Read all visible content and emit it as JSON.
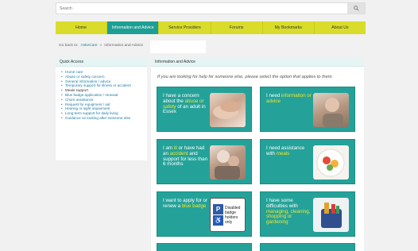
{
  "search": {
    "placeholder": "Search"
  },
  "nav": {
    "items": [
      {
        "label": "Home"
      },
      {
        "label": "Information and Advice"
      },
      {
        "label": "Service Providers"
      },
      {
        "label": "Forums"
      },
      {
        "label": "My Bookmarks"
      },
      {
        "label": "About Us"
      }
    ],
    "active_index": 1
  },
  "breadcrumb": {
    "prefix": "Go back to:",
    "link": "AskeCare",
    "separator": "»",
    "current": "Information and Advice"
  },
  "sidebar": {
    "title": "Quick Access",
    "items": [
      "Home care",
      "Abuse or safety concern",
      "General information / advice",
      "Temporary support for illness or accident",
      "Meals support",
      "Blue badge application / renewal",
      "Chore assistance",
      "Request for equipment / aid",
      "Hearing or sight impairment",
      "Long-term support for daily living",
      "Guidance on looking after someone else"
    ]
  },
  "main": {
    "title": "Information and Advice",
    "intro": "If you are looking for help for someone else, please select the option that applies to them.",
    "tiles": {
      "t1": {
        "a": "I have a concern about the ",
        "hl": "abuse or safety",
        "b": " of an adult in Essex"
      },
      "t2": {
        "a": "I need ",
        "hl": "information or advice",
        "b": ""
      },
      "t3": {
        "a": "I am ",
        "hl": "ill",
        "b": " or have had an ",
        "hl2": "accident",
        "c": " and support for less than 6 months"
      },
      "t4": {
        "a": "I need assistance with ",
        "hl": "meals",
        "b": ""
      },
      "t5": {
        "a": "I want to apply for or renew a ",
        "hl": "blue badge",
        "b": ""
      },
      "t6": {
        "a": "I have some difficulties with ",
        "hl": "managing, cleaning, shopping or gardening",
        "b": ""
      }
    },
    "badge_sign": {
      "p": "P",
      "wheel": "♿",
      "text": "Disabled badge holders only"
    }
  },
  "colors": {
    "nav_yellow": "#d9dc2a",
    "teal": "#1c9f94",
    "tile": "#24a29a",
    "highlight": "#f2e52b",
    "link": "#1a7aa8"
  }
}
